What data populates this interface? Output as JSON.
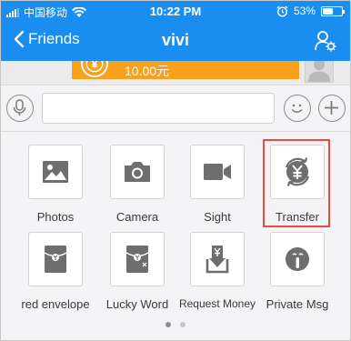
{
  "status_bar": {
    "carrier": "中国移动",
    "time": "10:22 PM",
    "battery": "53%",
    "battery_level": 0.53
  },
  "nav": {
    "back_label": "Friends",
    "title": "vivi"
  },
  "chat": {
    "amount": "10.00元"
  },
  "panel": {
    "tiles": [
      {
        "label": "Photos",
        "icon": "photo-icon"
      },
      {
        "label": "Camera",
        "icon": "camera-icon"
      },
      {
        "label": "Sight",
        "icon": "video-icon"
      },
      {
        "label": "Transfer",
        "icon": "transfer-icon"
      },
      {
        "label": "red envelope",
        "icon": "red-envelope-icon"
      },
      {
        "label": "Lucky Word",
        "icon": "lucky-word-icon"
      },
      {
        "label": "Request Money",
        "icon": "request-money-icon"
      },
      {
        "label": "Private Msg",
        "icon": "private-msg-icon"
      }
    ],
    "page_count": 2,
    "current_page": 1
  },
  "colors": {
    "header_blue": "#1a8df0",
    "bubble_orange": "#f9a11b",
    "highlight_red": "#e74c43",
    "icon_gray": "#6e6e6e"
  }
}
